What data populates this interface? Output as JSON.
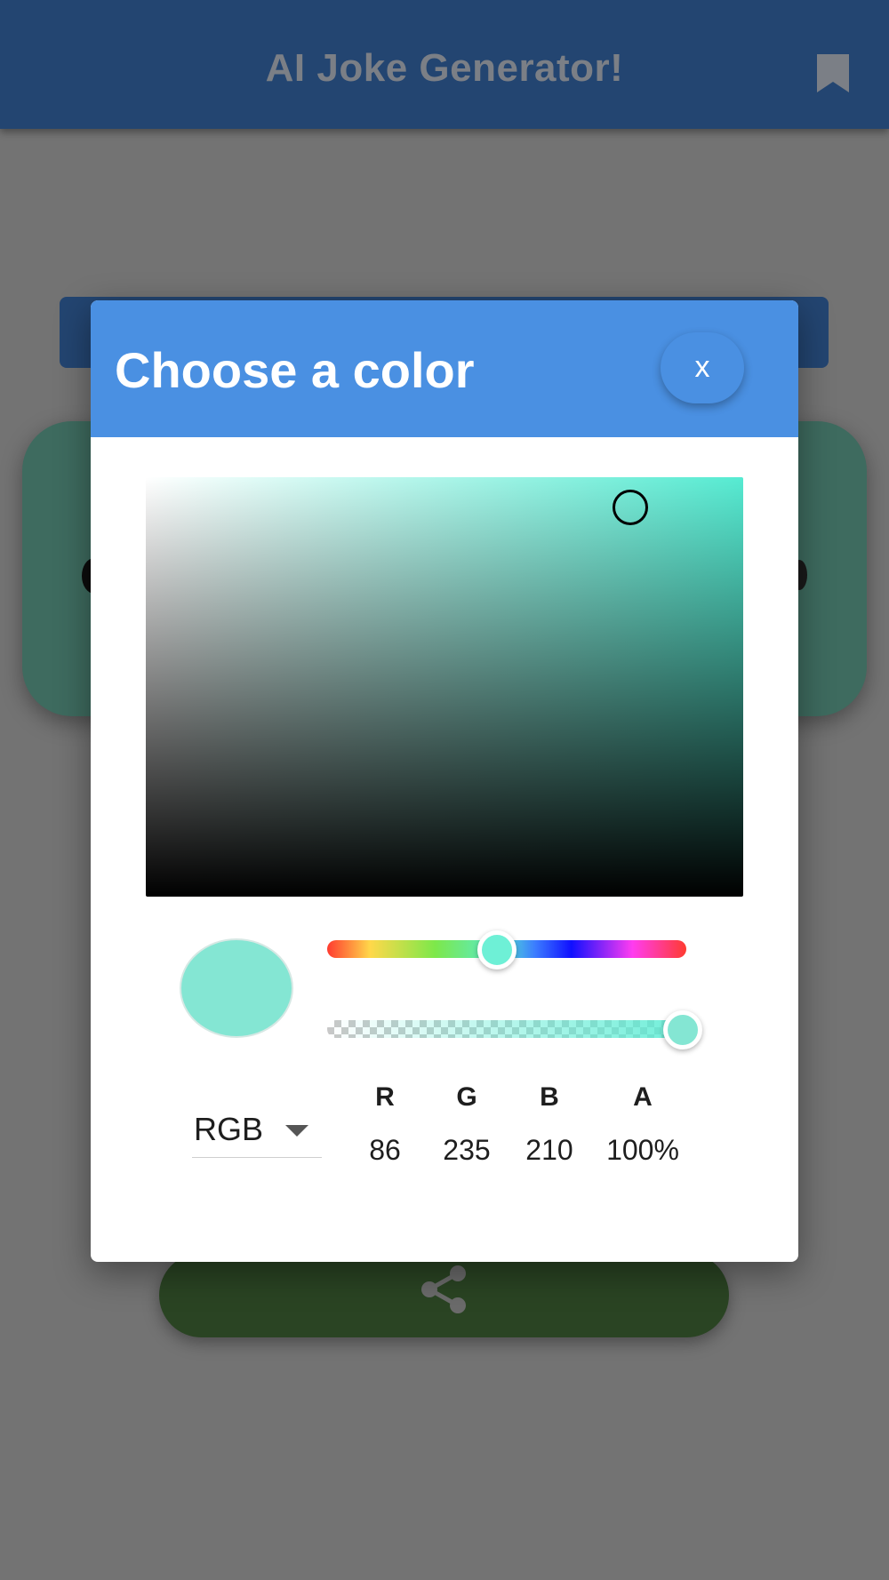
{
  "app": {
    "title": "AI Joke Generator!",
    "bookmark_icon": "bookmark-icon",
    "share_icon": "share-icon"
  },
  "dialog": {
    "title": "Choose a color",
    "close_label": "x",
    "selected_color": "#56ebd2",
    "hue_level": 0.47,
    "alpha_level": 1.0,
    "mode": "RGB",
    "channels": [
      {
        "label": "R",
        "value": "86"
      },
      {
        "label": "G",
        "value": "235"
      },
      {
        "label": "B",
        "value": "210"
      },
      {
        "label": "A",
        "value": "100%"
      }
    ]
  },
  "colors": {
    "app_bar": "#234571",
    "dialog_header": "#4a90e2",
    "card": "#3e6b5f",
    "share_button": "#2a4423"
  }
}
